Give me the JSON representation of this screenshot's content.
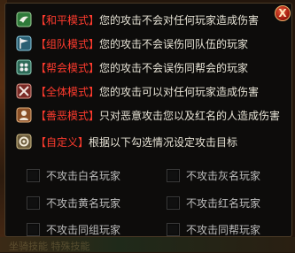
{
  "close": {
    "label": "X"
  },
  "modes": [
    {
      "icon": "peace-dove-icon",
      "name": "【和平模式】",
      "desc": "您的攻击不会对任何玩家造成伤害"
    },
    {
      "icon": "team-flag-icon",
      "name": "【组队模式】",
      "desc": "您的攻击不会误伤同队伍的玩家"
    },
    {
      "icon": "guild-icon",
      "name": "【帮会模式】",
      "desc": "您的攻击不会误伤同帮会的玩家"
    },
    {
      "icon": "crossed-swords-icon",
      "name": "【全体模式】",
      "desc": "您的攻击可以对任何玩家造成伤害"
    },
    {
      "icon": "good-evil-icon",
      "name": "【善恶模式】",
      "desc": "只对恶意攻击您以及红名的人造成伤害"
    },
    {
      "icon": "custom-gear-icon",
      "name": "【自定义】",
      "desc": "根据以下勾选情况设定攻击目标"
    }
  ],
  "options": [
    {
      "label": "不攻击白名玩家",
      "checked": false
    },
    {
      "label": "不攻击灰名玩家",
      "checked": false
    },
    {
      "label": "不攻击黄名玩家",
      "checked": false
    },
    {
      "label": "不攻击红名玩家",
      "checked": false
    },
    {
      "label": "不攻击同组玩家",
      "checked": false
    },
    {
      "label": "不攻击同帮玩家",
      "checked": false
    }
  ],
  "background": {
    "bottom_text": "坐骑技能 特殊技能"
  }
}
